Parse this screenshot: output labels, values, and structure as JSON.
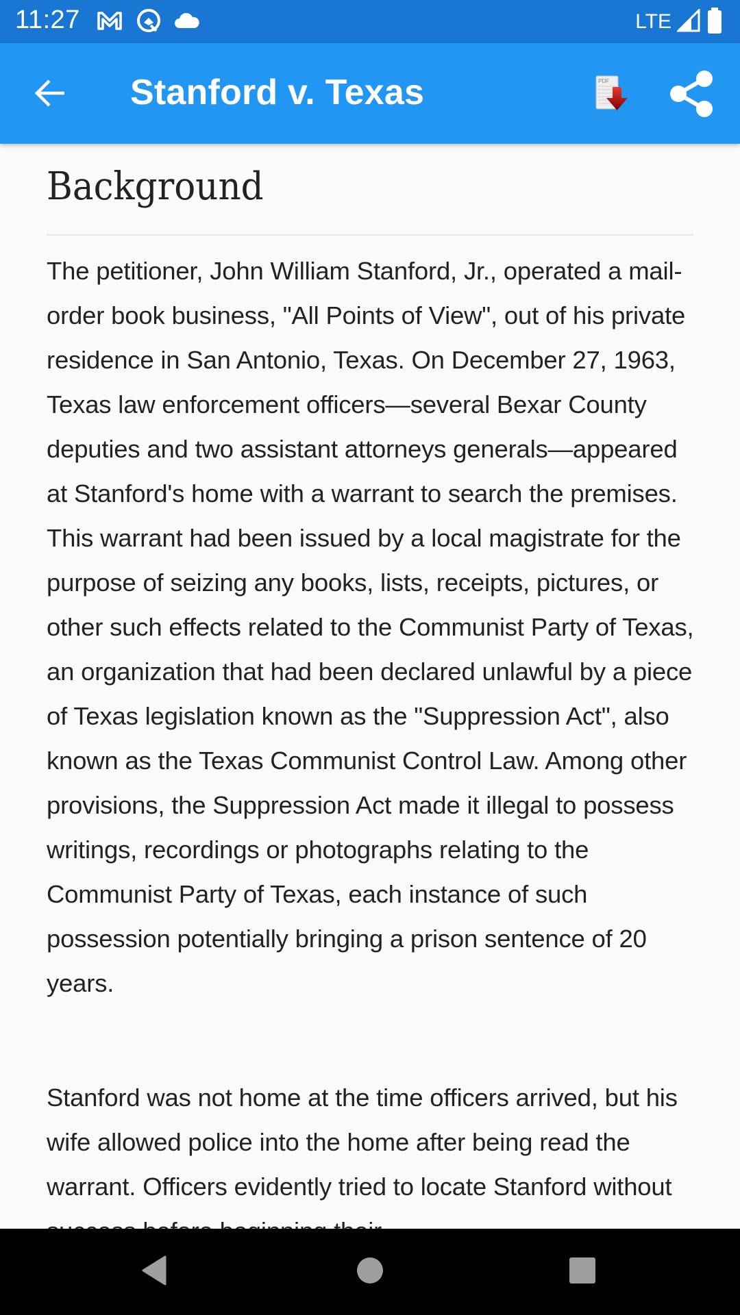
{
  "status_bar": {
    "time": "11:27",
    "left_icons": [
      "gmail-icon",
      "quick-access-icon",
      "cloud-icon"
    ],
    "network": "LTE",
    "right_icons": [
      "signal-icon",
      "battery-icon"
    ]
  },
  "app_bar": {
    "title": "Stanford v. Texas",
    "back_icon": "arrow-back-icon",
    "actions": [
      {
        "name": "download-pdf",
        "icon": "pdf-download-icon",
        "badge_text": "PDF"
      },
      {
        "name": "share",
        "icon": "share-icon"
      }
    ],
    "colors": {
      "status_bar": "#1976d2",
      "app_bar": "#2196f3",
      "pdf_arrow": "#c62828"
    }
  },
  "article": {
    "section_heading": "Background",
    "paragraphs": [
      "The petitioner, John William Stanford, Jr., operated a mail-order book business, \"All Points of View\", out of his private residence in San Antonio, Texas. On December 27, 1963, Texas law enforcement officers—several Bexar County deputies and two assistant attorneys generals—appeared at Stanford's home with a warrant to search the premises. This warrant had been issued by a local magistrate for the purpose of seizing any books, lists, receipts, pictures, or other such effects related to the Communist Party of Texas, an organization that had been declared unlawful by a piece of Texas legislation known as the \"Suppression Act\", also known as the Texas Communist Control Law. Among other provisions, the Suppression Act made it illegal to possess writings, recordings or photographs relating to the Communist Party of Texas, each instance of such possession potentially bringing a prison sentence of 20 years.",
      "Stanford was not home at the time officers arrived, but his wife allowed police into the home after being read the warrant. Officers evidently tried to locate Stanford without success before beginning their"
    ]
  },
  "nav_bar": {
    "buttons": [
      "back",
      "home",
      "recents"
    ]
  }
}
